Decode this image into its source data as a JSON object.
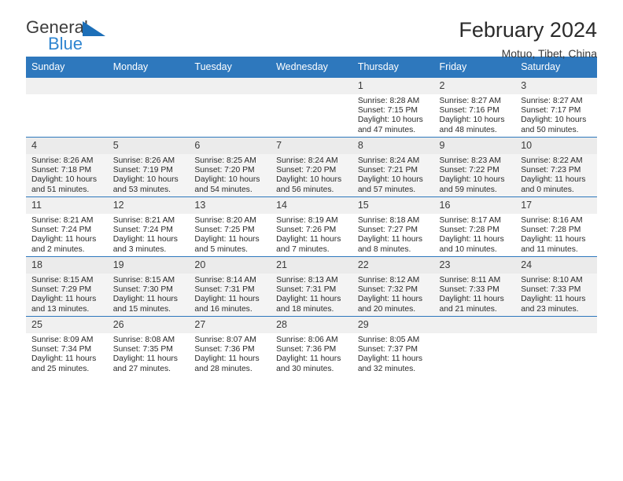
{
  "brand": {
    "name_part1": "General",
    "name_part2": "Blue",
    "triangle_color": "#1d6fb8",
    "blue_text_color": "#2f85d0"
  },
  "header": {
    "month_title": "February 2024",
    "location": "Motuo, Tibet, China"
  },
  "theme": {
    "header_row_bg": "#2e78bd",
    "header_row_text": "#ffffff",
    "alt_row_bg": "#f4f4f4",
    "daynum_bg": "#f0f0f0"
  },
  "weekdays": [
    "Sunday",
    "Monday",
    "Tuesday",
    "Wednesday",
    "Thursday",
    "Friday",
    "Saturday"
  ],
  "calendar": {
    "weeks": [
      [
        {
          "day": "",
          "sunrise": "",
          "sunset": "",
          "daylight1": "",
          "daylight2": ""
        },
        {
          "day": "",
          "sunrise": "",
          "sunset": "",
          "daylight1": "",
          "daylight2": ""
        },
        {
          "day": "",
          "sunrise": "",
          "sunset": "",
          "daylight1": "",
          "daylight2": ""
        },
        {
          "day": "",
          "sunrise": "",
          "sunset": "",
          "daylight1": "",
          "daylight2": ""
        },
        {
          "day": "1",
          "sunrise": "Sunrise: 8:28 AM",
          "sunset": "Sunset: 7:15 PM",
          "daylight1": "Daylight: 10 hours",
          "daylight2": "and 47 minutes."
        },
        {
          "day": "2",
          "sunrise": "Sunrise: 8:27 AM",
          "sunset": "Sunset: 7:16 PM",
          "daylight1": "Daylight: 10 hours",
          "daylight2": "and 48 minutes."
        },
        {
          "day": "3",
          "sunrise": "Sunrise: 8:27 AM",
          "sunset": "Sunset: 7:17 PM",
          "daylight1": "Daylight: 10 hours",
          "daylight2": "and 50 minutes."
        }
      ],
      [
        {
          "day": "4",
          "sunrise": "Sunrise: 8:26 AM",
          "sunset": "Sunset: 7:18 PM",
          "daylight1": "Daylight: 10 hours",
          "daylight2": "and 51 minutes."
        },
        {
          "day": "5",
          "sunrise": "Sunrise: 8:26 AM",
          "sunset": "Sunset: 7:19 PM",
          "daylight1": "Daylight: 10 hours",
          "daylight2": "and 53 minutes."
        },
        {
          "day": "6",
          "sunrise": "Sunrise: 8:25 AM",
          "sunset": "Sunset: 7:20 PM",
          "daylight1": "Daylight: 10 hours",
          "daylight2": "and 54 minutes."
        },
        {
          "day": "7",
          "sunrise": "Sunrise: 8:24 AM",
          "sunset": "Sunset: 7:20 PM",
          "daylight1": "Daylight: 10 hours",
          "daylight2": "and 56 minutes."
        },
        {
          "day": "8",
          "sunrise": "Sunrise: 8:24 AM",
          "sunset": "Sunset: 7:21 PM",
          "daylight1": "Daylight: 10 hours",
          "daylight2": "and 57 minutes."
        },
        {
          "day": "9",
          "sunrise": "Sunrise: 8:23 AM",
          "sunset": "Sunset: 7:22 PM",
          "daylight1": "Daylight: 10 hours",
          "daylight2": "and 59 minutes."
        },
        {
          "day": "10",
          "sunrise": "Sunrise: 8:22 AM",
          "sunset": "Sunset: 7:23 PM",
          "daylight1": "Daylight: 11 hours",
          "daylight2": "and 0 minutes."
        }
      ],
      [
        {
          "day": "11",
          "sunrise": "Sunrise: 8:21 AM",
          "sunset": "Sunset: 7:24 PM",
          "daylight1": "Daylight: 11 hours",
          "daylight2": "and 2 minutes."
        },
        {
          "day": "12",
          "sunrise": "Sunrise: 8:21 AM",
          "sunset": "Sunset: 7:24 PM",
          "daylight1": "Daylight: 11 hours",
          "daylight2": "and 3 minutes."
        },
        {
          "day": "13",
          "sunrise": "Sunrise: 8:20 AM",
          "sunset": "Sunset: 7:25 PM",
          "daylight1": "Daylight: 11 hours",
          "daylight2": "and 5 minutes."
        },
        {
          "day": "14",
          "sunrise": "Sunrise: 8:19 AM",
          "sunset": "Sunset: 7:26 PM",
          "daylight1": "Daylight: 11 hours",
          "daylight2": "and 7 minutes."
        },
        {
          "day": "15",
          "sunrise": "Sunrise: 8:18 AM",
          "sunset": "Sunset: 7:27 PM",
          "daylight1": "Daylight: 11 hours",
          "daylight2": "and 8 minutes."
        },
        {
          "day": "16",
          "sunrise": "Sunrise: 8:17 AM",
          "sunset": "Sunset: 7:28 PM",
          "daylight1": "Daylight: 11 hours",
          "daylight2": "and 10 minutes."
        },
        {
          "day": "17",
          "sunrise": "Sunrise: 8:16 AM",
          "sunset": "Sunset: 7:28 PM",
          "daylight1": "Daylight: 11 hours",
          "daylight2": "and 11 minutes."
        }
      ],
      [
        {
          "day": "18",
          "sunrise": "Sunrise: 8:15 AM",
          "sunset": "Sunset: 7:29 PM",
          "daylight1": "Daylight: 11 hours",
          "daylight2": "and 13 minutes."
        },
        {
          "day": "19",
          "sunrise": "Sunrise: 8:15 AM",
          "sunset": "Sunset: 7:30 PM",
          "daylight1": "Daylight: 11 hours",
          "daylight2": "and 15 minutes."
        },
        {
          "day": "20",
          "sunrise": "Sunrise: 8:14 AM",
          "sunset": "Sunset: 7:31 PM",
          "daylight1": "Daylight: 11 hours",
          "daylight2": "and 16 minutes."
        },
        {
          "day": "21",
          "sunrise": "Sunrise: 8:13 AM",
          "sunset": "Sunset: 7:31 PM",
          "daylight1": "Daylight: 11 hours",
          "daylight2": "and 18 minutes."
        },
        {
          "day": "22",
          "sunrise": "Sunrise: 8:12 AM",
          "sunset": "Sunset: 7:32 PM",
          "daylight1": "Daylight: 11 hours",
          "daylight2": "and 20 minutes."
        },
        {
          "day": "23",
          "sunrise": "Sunrise: 8:11 AM",
          "sunset": "Sunset: 7:33 PM",
          "daylight1": "Daylight: 11 hours",
          "daylight2": "and 21 minutes."
        },
        {
          "day": "24",
          "sunrise": "Sunrise: 8:10 AM",
          "sunset": "Sunset: 7:33 PM",
          "daylight1": "Daylight: 11 hours",
          "daylight2": "and 23 minutes."
        }
      ],
      [
        {
          "day": "25",
          "sunrise": "Sunrise: 8:09 AM",
          "sunset": "Sunset: 7:34 PM",
          "daylight1": "Daylight: 11 hours",
          "daylight2": "and 25 minutes."
        },
        {
          "day": "26",
          "sunrise": "Sunrise: 8:08 AM",
          "sunset": "Sunset: 7:35 PM",
          "daylight1": "Daylight: 11 hours",
          "daylight2": "and 27 minutes."
        },
        {
          "day": "27",
          "sunrise": "Sunrise: 8:07 AM",
          "sunset": "Sunset: 7:36 PM",
          "daylight1": "Daylight: 11 hours",
          "daylight2": "and 28 minutes."
        },
        {
          "day": "28",
          "sunrise": "Sunrise: 8:06 AM",
          "sunset": "Sunset: 7:36 PM",
          "daylight1": "Daylight: 11 hours",
          "daylight2": "and 30 minutes."
        },
        {
          "day": "29",
          "sunrise": "Sunrise: 8:05 AM",
          "sunset": "Sunset: 7:37 PM",
          "daylight1": "Daylight: 11 hours",
          "daylight2": "and 32 minutes."
        },
        {
          "day": "",
          "sunrise": "",
          "sunset": "",
          "daylight1": "",
          "daylight2": ""
        },
        {
          "day": "",
          "sunrise": "",
          "sunset": "",
          "daylight1": "",
          "daylight2": ""
        }
      ]
    ]
  }
}
